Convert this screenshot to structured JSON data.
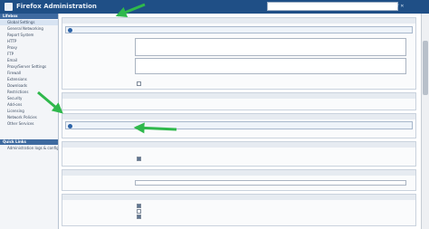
{
  "app": {
    "title": "Firefox Administration"
  },
  "sidebar": {
    "heading_top": "Lifebox",
    "items": [
      {
        "label": "Global Settings"
      },
      {
        "label": "General Networking"
      },
      {
        "label": "Report System"
      },
      {
        "label": "HTTP"
      },
      {
        "label": "Proxy"
      },
      {
        "label": "FTP"
      },
      {
        "label": "Email"
      },
      {
        "label": "Proxy/Server Settings"
      },
      {
        "label": "Firewall"
      },
      {
        "label": "Extensions"
      },
      {
        "label": "Downloads"
      },
      {
        "label": "Restrictions"
      },
      {
        "label": "Security"
      },
      {
        "label": "Add-ons"
      },
      {
        "label": "Licensing"
      },
      {
        "label": "Network Policies"
      },
      {
        "label": "Other Services"
      }
    ],
    "heading_bottom": "Quick Links",
    "quick_links": [
      {
        "label": "Administration logs & config"
      }
    ]
  },
  "colors": {
    "header_bg": "#1f4f86",
    "sidebar_head": "#3e6aa0",
    "arrow": "#2fb84c"
  },
  "icons": [
    "app-logo-icon",
    "info-icon",
    "arrow-icon"
  ]
}
